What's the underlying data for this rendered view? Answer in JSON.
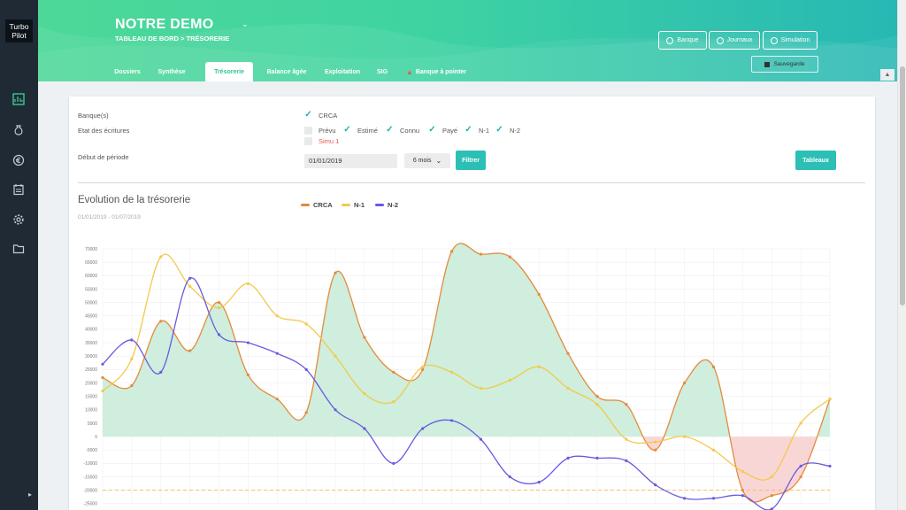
{
  "app": {
    "logo_line1": "Turbo",
    "logo_line2": "Pilot"
  },
  "sidebar": {
    "icons": [
      "dashboard-icon",
      "money-bag-icon",
      "euro-coin-icon",
      "calendar-icon",
      "gear-icon",
      "folder-icon"
    ],
    "expand_glyph": "▸"
  },
  "header": {
    "org_name": "NOTRE DEMO",
    "chevron": "⌄",
    "breadcrumb": "TABLEAU DE BORD > TRÉSORERIE",
    "buttons": {
      "bank": "Banque",
      "journals": "Journaux",
      "simulation": "Simulation"
    },
    "save_label": "Sauvegarde"
  },
  "tabs": [
    {
      "label": "Dossiers"
    },
    {
      "label": "Synthèse"
    },
    {
      "label": "Trésorerie"
    },
    {
      "label": "Balance âgée"
    },
    {
      "label": "Exploitation"
    },
    {
      "label": "SIG"
    },
    {
      "label": "Banque à pointer"
    }
  ],
  "filters": {
    "banks_label": "Banque(s)",
    "banks_value": "CRCA",
    "entries_label": "Etat des écritures",
    "entries": [
      {
        "label": "Prévu",
        "checked": false
      },
      {
        "label": "Estimé",
        "checked": true
      },
      {
        "label": "Connu",
        "checked": true
      },
      {
        "label": "Payé",
        "checked": true
      },
      {
        "label": "N-1",
        "checked": true
      },
      {
        "label": "N-2",
        "checked": true
      }
    ],
    "simu_label": "Simu 1",
    "period_label": "Début de période",
    "date_value": "01/01/2019",
    "period_select": "6 mois",
    "filter_button": "Filtrer",
    "tables_button": "Tableaux"
  },
  "colors": {
    "accent": "#2cbfb5",
    "crca": "#e38b3a",
    "n1": "#f2c94c",
    "n2": "#6a5ae0",
    "positive_fill": "#cfeedd",
    "negative_fill": "#f9d6d6",
    "simu_text": "#e35a4c"
  },
  "chart_data": {
    "type": "line",
    "title": "Evolution de la trésorerie",
    "subtitle": "01/01/2019 - 01/07/2019",
    "legend_position": "top",
    "ylim": [
      -25000,
      70000
    ],
    "yticks": [
      "70000",
      "65000",
      "60000",
      "55000",
      "50000",
      "45000",
      "40000",
      "35000",
      "30000",
      "25000",
      "20000",
      "15000",
      "10000",
      "5000",
      "0",
      "-5000",
      "-10000",
      "-15000",
      "-20000",
      "-25000"
    ],
    "threshold": -20000,
    "grid": true,
    "series": [
      {
        "name": "CRCA",
        "values": [
          22000,
          19000,
          43000,
          32000,
          50000,
          23000,
          14000,
          9000,
          61000,
          37000,
          24000,
          25000,
          69000,
          68000,
          67000,
          53000,
          31000,
          15000,
          12000,
          -5000,
          20000,
          26000,
          -20000,
          -22000,
          -15000,
          14000
        ]
      },
      {
        "name": "N-1",
        "values": [
          17000,
          29000,
          67000,
          56000,
          48000,
          57000,
          45000,
          42000,
          30000,
          16000,
          13000,
          26000,
          24000,
          18000,
          21000,
          26000,
          18000,
          12000,
          -1000,
          -2000,
          0,
          -5000,
          -13000,
          -15000,
          5000,
          14000
        ]
      },
      {
        "name": "N-2",
        "values": [
          27000,
          36000,
          24000,
          59000,
          38000,
          35000,
          31000,
          25000,
          10000,
          3000,
          -10000,
          3000,
          6000,
          -1000,
          -15000,
          -17000,
          -8000,
          -8000,
          -9000,
          -18000,
          -23000,
          -23000,
          -22000,
          -27000,
          -11000,
          -11000
        ]
      }
    ]
  }
}
